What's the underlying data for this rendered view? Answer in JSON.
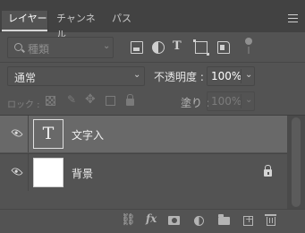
{
  "tabs": [
    {
      "label": "レイヤー",
      "active": true
    },
    {
      "label": "チャンネル",
      "active": false
    },
    {
      "label": "パス",
      "active": false
    }
  ],
  "filter": {
    "kind_placeholder": "種類",
    "icons": [
      "image-filter-icon",
      "adjustment-filter-icon",
      "type-filter-icon",
      "shape-filter-icon",
      "smart-object-filter-icon",
      "filter-toggle-icon"
    ]
  },
  "blend": {
    "mode": "通常",
    "opacity_label": "不透明度 :",
    "opacity_value": "100%"
  },
  "lock": {
    "label": "ロック :",
    "fill_label": "塗り :",
    "fill_value": "100%"
  },
  "layers": [
    {
      "name": "文字入",
      "thumb_type": "text",
      "thumb_glyph": "T",
      "selected": true,
      "locked": false
    },
    {
      "name": "背景",
      "thumb_type": "white",
      "thumb_glyph": "",
      "selected": false,
      "locked": true
    }
  ],
  "bottom_icons": [
    "link-layers-icon",
    "fx-icon",
    "layer-mask-icon",
    "adjustment-layer-icon",
    "new-group-icon",
    "new-layer-icon",
    "trash-icon"
  ],
  "colors": {
    "panel_bg": "#535353",
    "tabbar_bg": "#424242",
    "selected_row": "#696969"
  }
}
